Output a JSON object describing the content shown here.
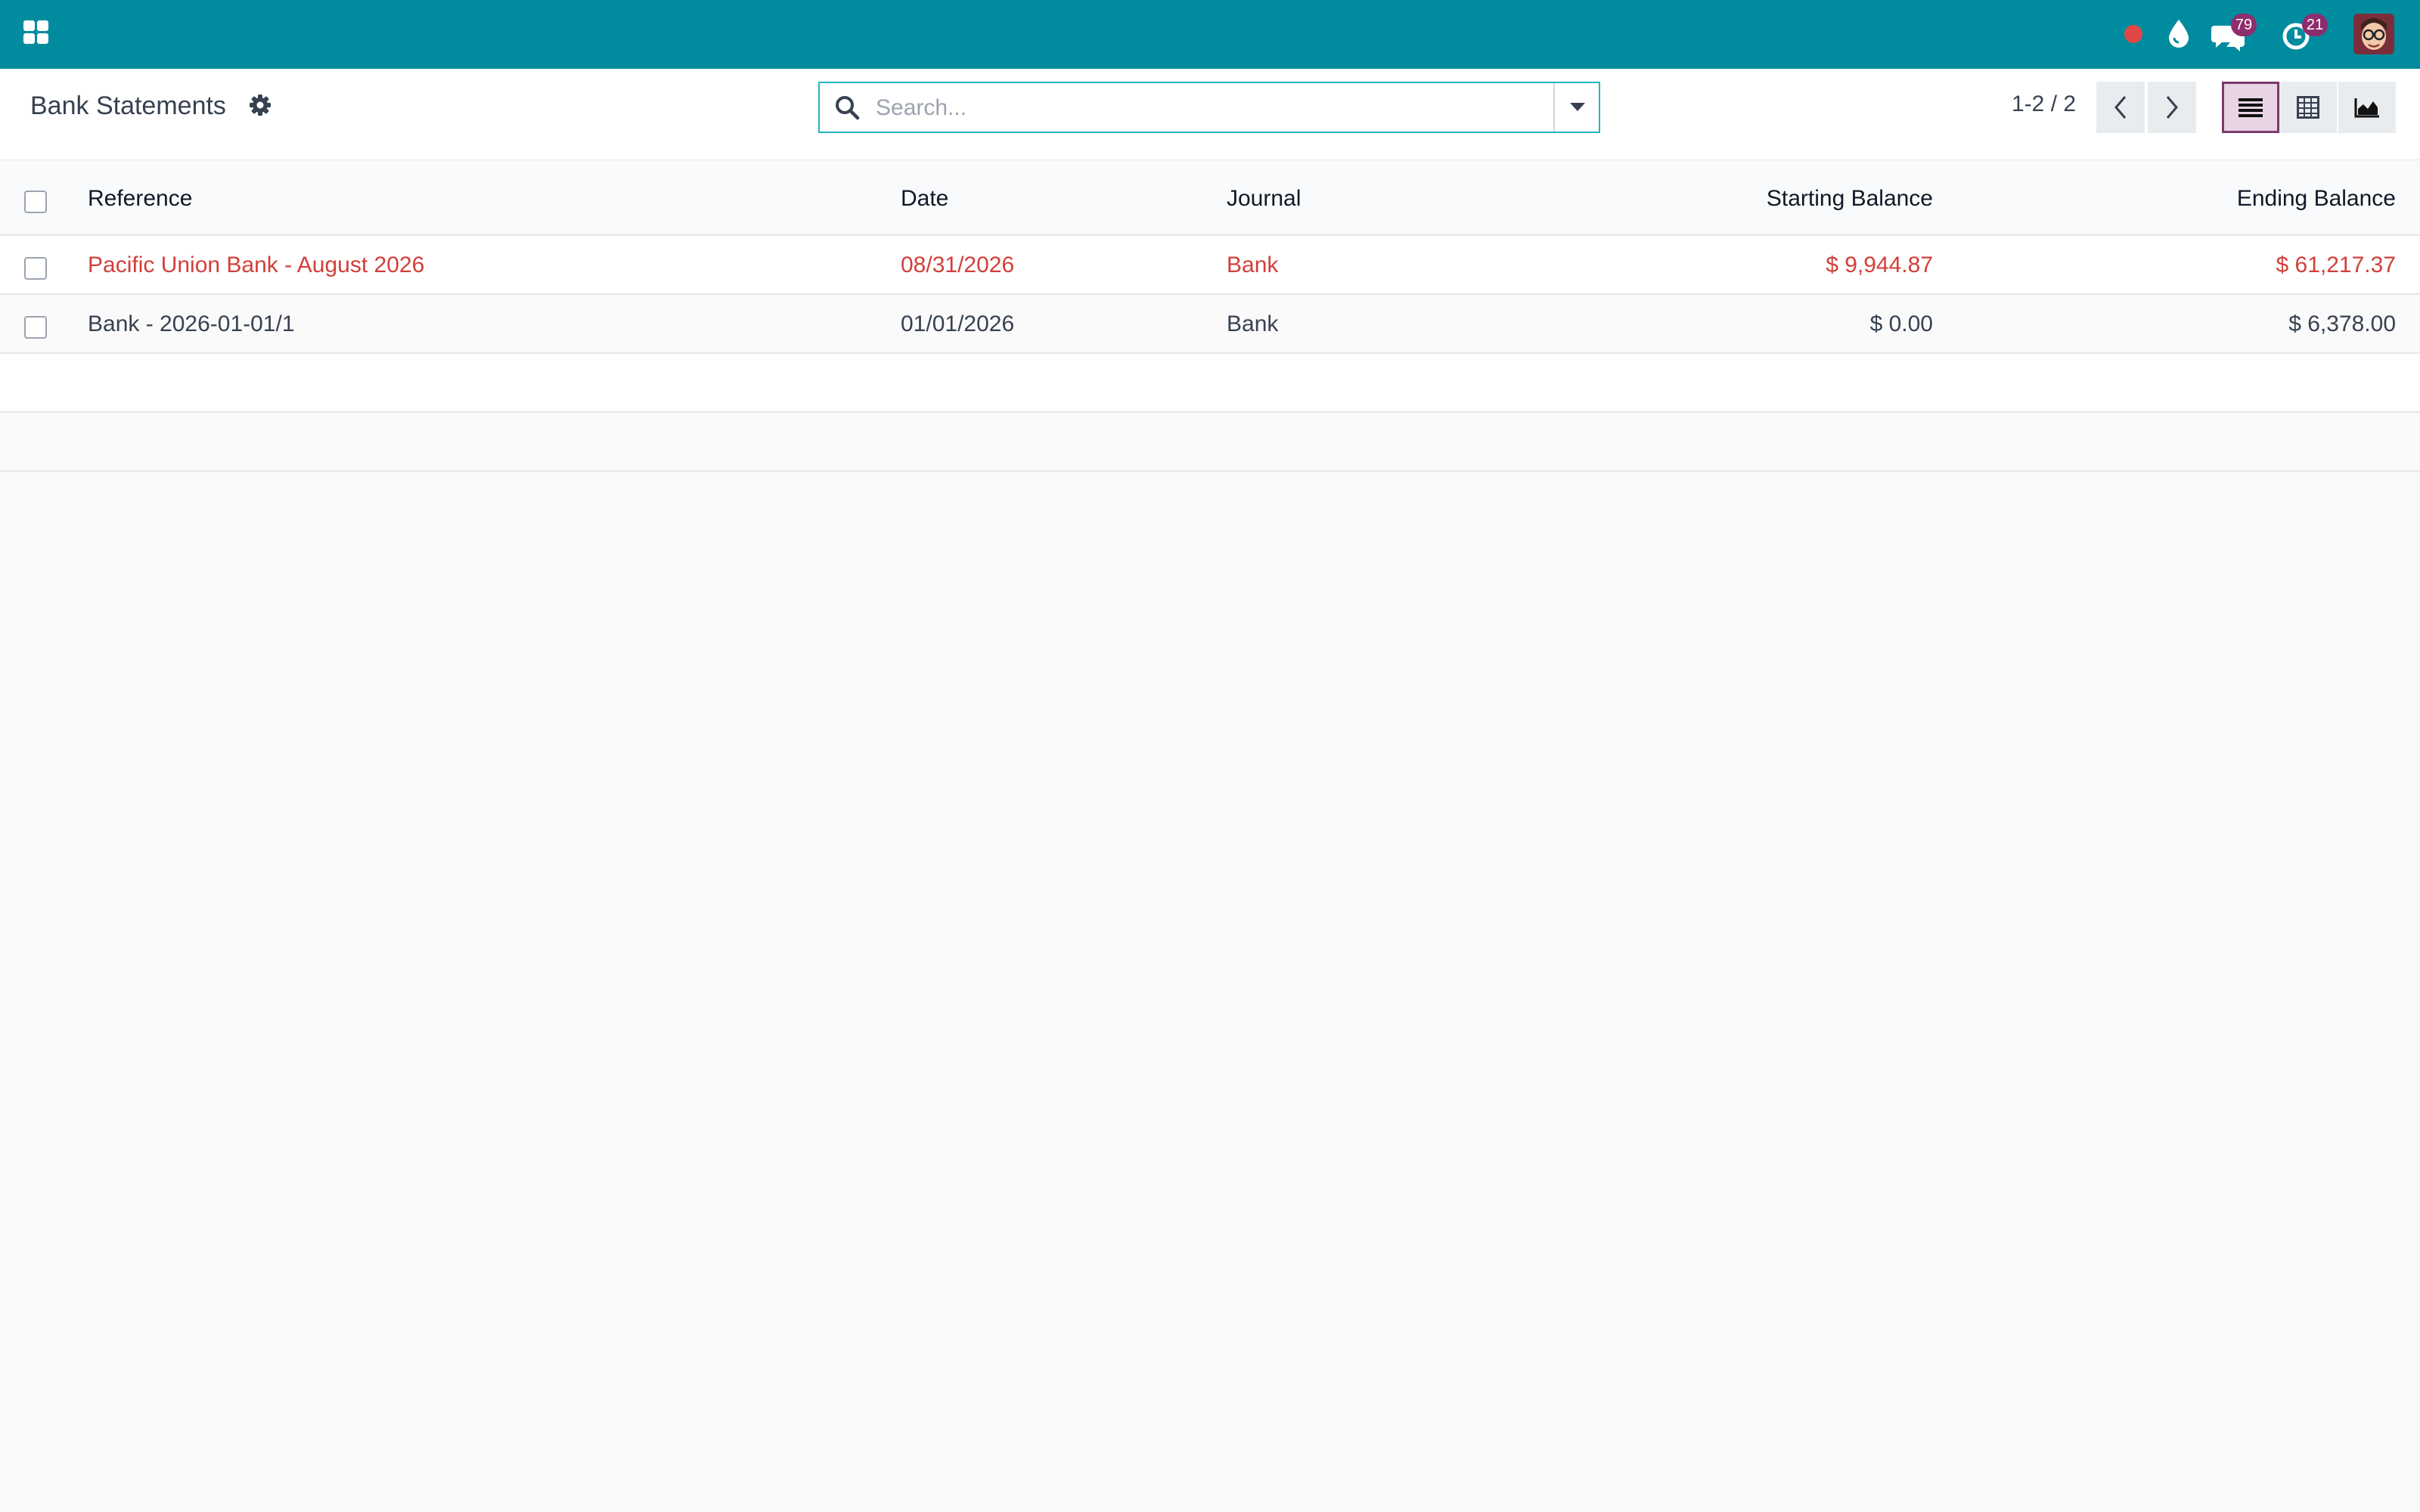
{
  "navbar": {
    "messages_badge": "79",
    "activities_badge": "21"
  },
  "control_panel": {
    "title": "Bank Statements",
    "search": {
      "placeholder": "Search...",
      "value": ""
    },
    "pager": {
      "value": "1-2 / 2"
    }
  },
  "table": {
    "columns": [
      "Reference",
      "Date",
      "Journal",
      "Starting Balance",
      "Ending Balance"
    ],
    "rows": [
      {
        "reference": "Pacific Union Bank - August 2026",
        "date": "08/31/2026",
        "journal": "Bank",
        "starting_balance": "$ 9,944.87",
        "ending_balance": "$ 61,217.37",
        "highlight": "red"
      },
      {
        "reference": "Bank - 2026-01-01/1",
        "date": "01/01/2026",
        "journal": "Bank",
        "starting_balance": "$ 0.00",
        "ending_balance": "$ 6,378.00",
        "highlight": "none"
      }
    ]
  },
  "colors": {
    "navbar": "#008b9e",
    "accent": "#7c3a6a",
    "badge": "#8e2d6e",
    "warning_row": "#d23f3a"
  },
  "icons": {
    "apps": "apps-grid-icon",
    "recording": "red-dot-icon",
    "drop": "water-drop-icon",
    "messages": "chat-bubbles-icon",
    "activities": "clock-icon",
    "settings": "gear-icon",
    "search": "search-icon",
    "dropdown": "caret-down-icon",
    "prev": "chevron-left-icon",
    "next": "chevron-right-icon",
    "list_view": "list-view-icon",
    "pivot_view": "pivot-view-icon",
    "graph_view": "area-chart-icon"
  }
}
